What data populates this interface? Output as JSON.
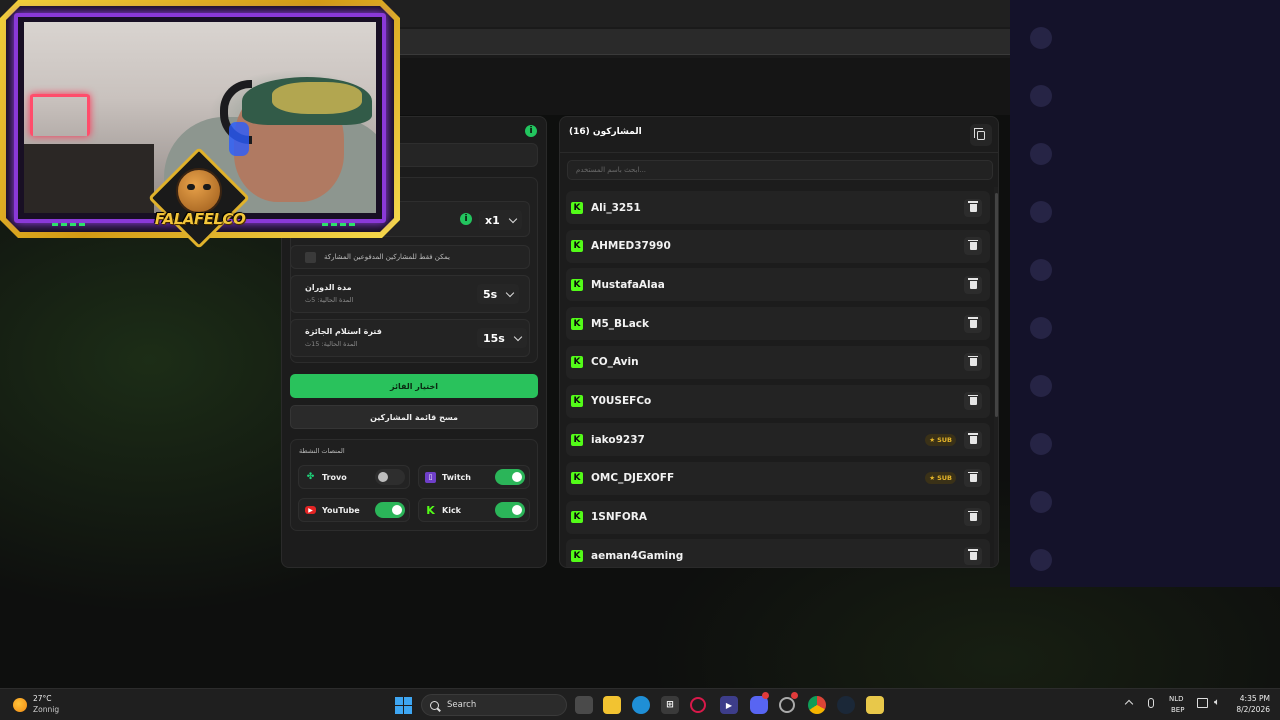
{
  "settings": {
    "multiplier_value": "x1",
    "paid_only_label": "يمكن فقط للمشاركين المدفوعين المشاركة",
    "spin_duration": {
      "title": "مدة الدوران",
      "subtitle": "المدة الحالية: 5ث",
      "value": "5s"
    },
    "claim_period": {
      "title": "فترة استلام الجائزة",
      "subtitle": "المدة الحالية: 15ث",
      "value": "15s"
    },
    "pick_winner_label": "اختيار الفائز",
    "clear_list_label": "مسح قائمة المشاركين",
    "platforms_title": "المنصات النشطة",
    "platforms": [
      {
        "name": "Trovo",
        "enabled": false
      },
      {
        "name": "Twitch",
        "enabled": true
      },
      {
        "name": "YouTube",
        "enabled": true
      },
      {
        "name": "Kick",
        "enabled": true
      }
    ]
  },
  "participants": {
    "title": "المشاركون (16)",
    "search_placeholder": "ابحث باسم المستخدم...",
    "sub_badge": "SUB",
    "rows": [
      {
        "name": "Ali_3251",
        "sub": false
      },
      {
        "name": "AHMED37990",
        "sub": false
      },
      {
        "name": "MustafaAlaa",
        "sub": false
      },
      {
        "name": "M5_BLack",
        "sub": false
      },
      {
        "name": "CO_Avin",
        "sub": false
      },
      {
        "name": "Y0USEFCo",
        "sub": false
      },
      {
        "name": "iako9237",
        "sub": true
      },
      {
        "name": "OMC_DJEXOFF",
        "sub": true
      },
      {
        "name": "1SNFORA",
        "sub": false
      },
      {
        "name": "aeman4Gaming",
        "sub": false
      }
    ]
  },
  "webcam": {
    "logo_text": "FALAFELCO"
  },
  "taskbar": {
    "weather_temp": "27°C",
    "weather_desc": "Zonnig",
    "search_label": "Search",
    "lang_line1": "NLD",
    "lang_line2": "BEP",
    "time": "4:35 PM",
    "date": "8/2/2026"
  },
  "colors": {
    "accent_green": "#29c25c",
    "kick_green": "#53fc18",
    "sub_gold": "#e6b629",
    "twitch_purple": "#9146ff",
    "youtube_red": "#ff0000"
  }
}
